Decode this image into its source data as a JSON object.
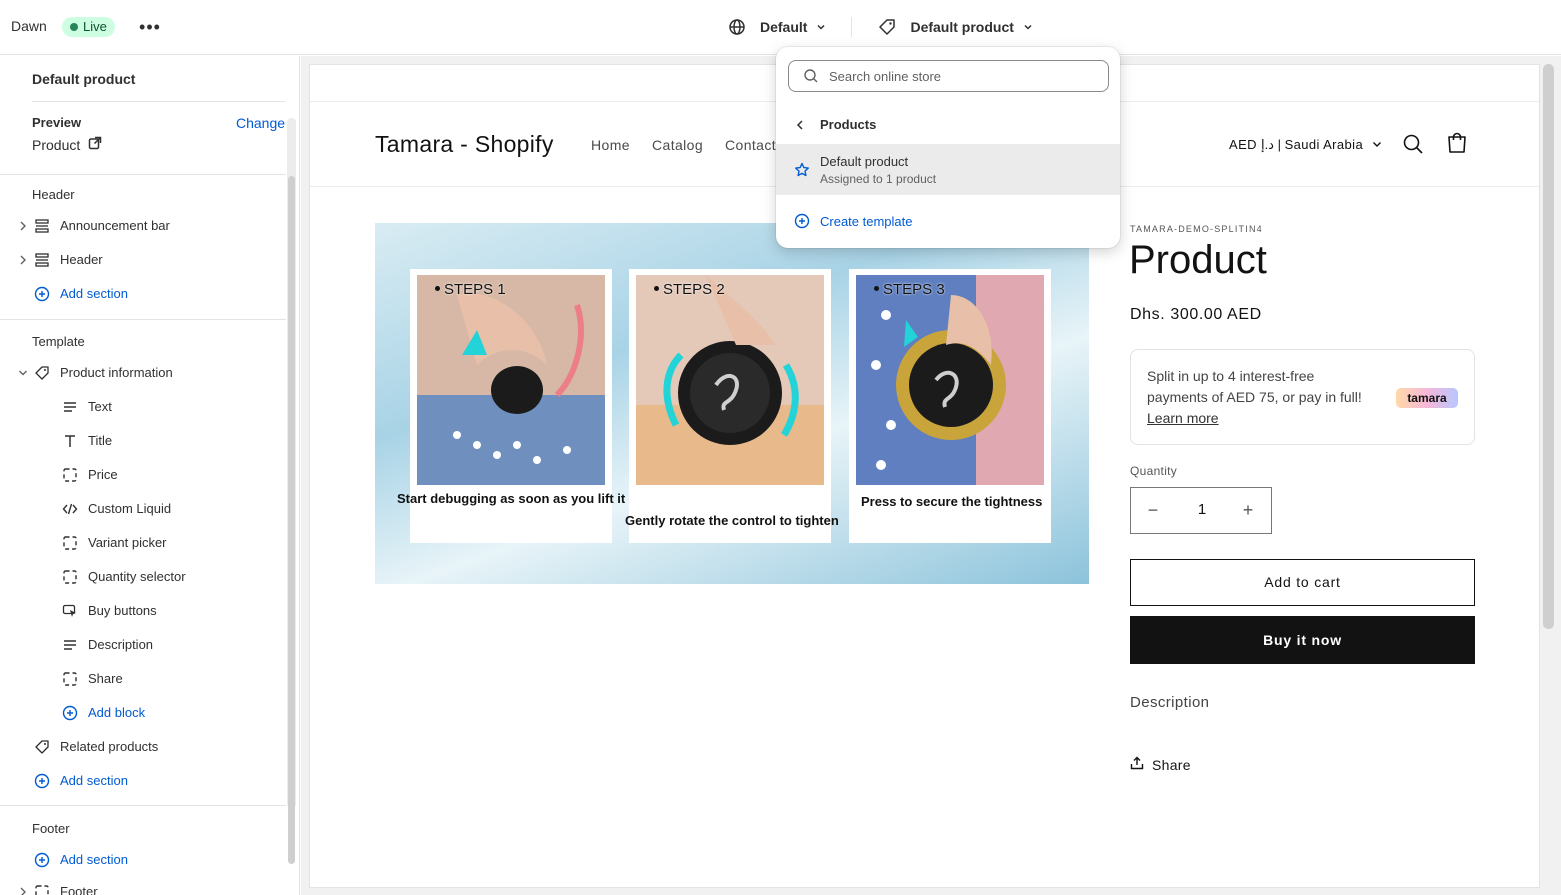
{
  "topbar": {
    "theme_name": "Dawn",
    "status_badge": "Live",
    "more_label": "•••",
    "language_selector": "Default",
    "template_selector": "Default product"
  },
  "sidebar": {
    "title": "Default product",
    "preview_label": "Preview",
    "change_link": "Change",
    "preview_value": "Product",
    "header_group": {
      "label": "Header",
      "items": [
        "Announcement bar",
        "Header"
      ],
      "add_section": "Add section"
    },
    "template_group": {
      "label": "Template",
      "section": "Product information",
      "blocks": [
        "Text",
        "Title",
        "Price",
        "Custom Liquid",
        "Variant picker",
        "Quantity selector",
        "Buy buttons",
        "Description",
        "Share"
      ],
      "add_block": "Add block",
      "related": "Related products",
      "add_section": "Add section"
    },
    "footer_group": {
      "label": "Footer",
      "add_section": "Add section",
      "items": [
        "Footer"
      ]
    }
  },
  "dropdown": {
    "search_placeholder": "Search online store",
    "back_label": "Products",
    "selected_item": {
      "title": "Default product",
      "subtitle": "Assigned to 1 product"
    },
    "create_label": "Create template"
  },
  "store": {
    "brand": "Tamara - Shopify",
    "nav": [
      "Home",
      "Catalog",
      "Contact"
    ],
    "currency": "AED د.إ | Saudi Arabia",
    "hero_steps": [
      {
        "title": "STEPS 1",
        "caption": "Start  debugging as soon as you lift it"
      },
      {
        "title": "STEPS 2",
        "caption": "Gently rotate the control to tighten"
      },
      {
        "title": "STEPS 3",
        "caption": "Press to secure the tightness"
      }
    ],
    "product": {
      "vendor": "TAMARA-DEMO-SPLITIN4",
      "title": "Product",
      "price": "Dhs. 300.00 AED",
      "tamara_text": "Split in up to 4 interest-free payments of AED 75, or pay in full!",
      "tamara_link": "Learn more",
      "tamara_logo": "tamara",
      "quantity_label": "Quantity",
      "quantity_minus": "−",
      "quantity_value": "1",
      "quantity_plus": "+",
      "add_to_cart": "Add to cart",
      "buy_now": "Buy it now",
      "description_label": "Description",
      "share_label": "Share"
    }
  },
  "colors": {
    "accent_link": "#005bd3",
    "live_bg": "#cdfee1",
    "live_dot": "#29845a",
    "buy_button": "#121212"
  }
}
